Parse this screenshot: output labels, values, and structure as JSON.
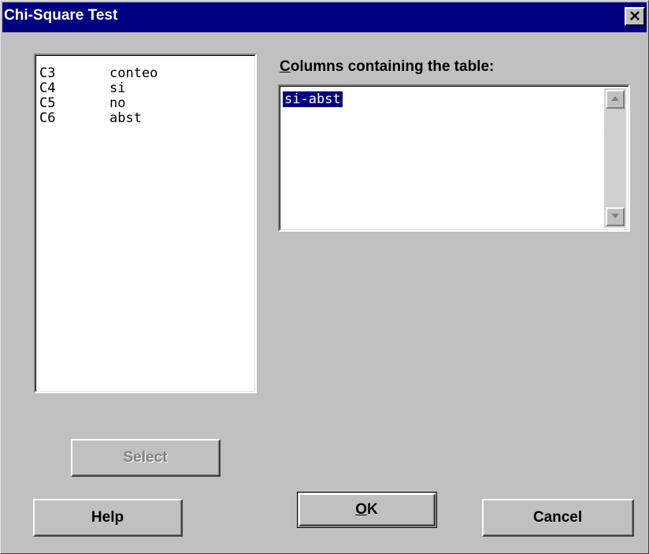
{
  "window": {
    "title": "Chi-Square Test"
  },
  "variables": [
    {
      "column": "C3",
      "name": "conteo"
    },
    {
      "column": "C4",
      "name": "si"
    },
    {
      "column": "C5",
      "name": "no"
    },
    {
      "column": "C6",
      "name": "abst"
    }
  ],
  "columns_field": {
    "label_mnemonic": "C",
    "label_rest": "olumns containing the table:",
    "value": "si-abst"
  },
  "buttons": {
    "select": "Select",
    "help": "Help",
    "ok_mnemonic": "O",
    "ok_rest": "K",
    "cancel": "Cancel"
  },
  "icons": {
    "close": "close-icon",
    "scroll_up": "arrow-up-icon",
    "scroll_down": "arrow-down-icon"
  },
  "colors": {
    "title_bar": "#000080",
    "dialog_face": "#c0c0c0",
    "selection": "#000080"
  }
}
